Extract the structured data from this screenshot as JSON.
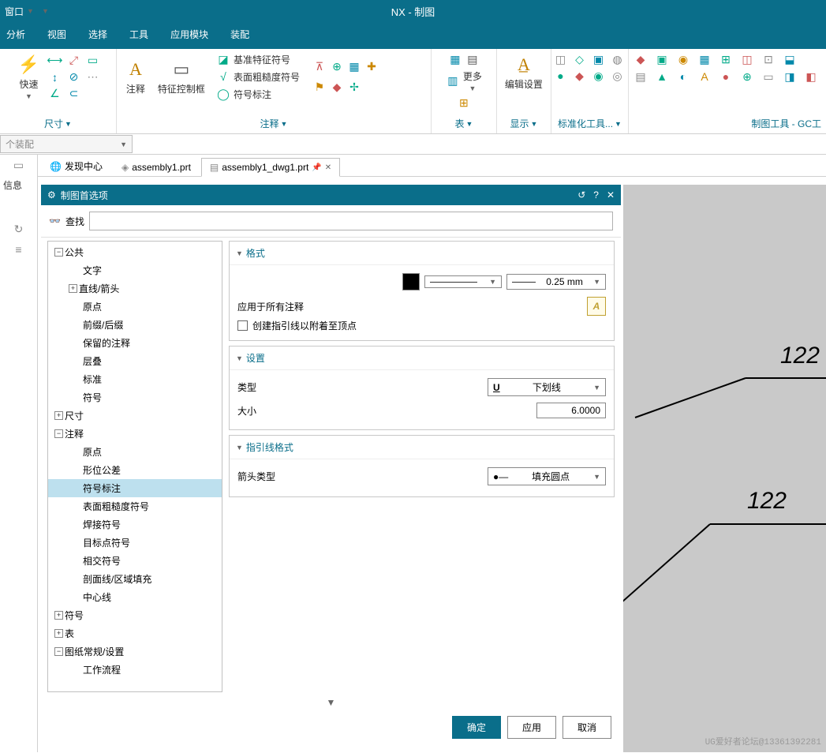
{
  "titlebar": {
    "window_menu": "窗口",
    "app_title": "NX - 制图"
  },
  "menubar": {
    "items": [
      "分析",
      "视图",
      "选择",
      "工具",
      "应用模块",
      "装配"
    ]
  },
  "ribbon": {
    "g1": {
      "quick": "快速",
      "label": "尺寸"
    },
    "g2": {
      "note": "注释",
      "featureFrame": "特征控制框",
      "opt1": "基准特征符号",
      "opt2": "表面粗糙度符号",
      "opt3": "符号标注",
      "label": "注释"
    },
    "g3": {
      "more": "更多",
      "label": "表"
    },
    "g4": {
      "edit": "编辑设置",
      "label": "显示"
    },
    "g5": {
      "label": "标准化工具..."
    },
    "g6": {
      "label": "制图工具 - GC工"
    }
  },
  "assemblyCombo": "个装配",
  "tabs": {
    "discover": "发现中心",
    "t1": "assembly1.prt",
    "t2": "assembly1_dwg1.prt"
  },
  "leftcol": {
    "info": "信息"
  },
  "dialog": {
    "title": "制图首选项",
    "searchLabel": "查找",
    "searchPlaceholder": "",
    "tree": {
      "n0": "公共",
      "n0c": [
        "文字",
        "直线/箭头",
        "原点",
        "前缀/后缀",
        "保留的注释",
        "层叠",
        "标准",
        "符号"
      ],
      "n1": "尺寸",
      "n2": "注释",
      "n2c": [
        "原点",
        "形位公差",
        "符号标注",
        "表面粗糙度符号",
        "焊接符号",
        "目标点符号",
        "相交符号",
        "剖面线/区域填充",
        "中心线"
      ],
      "n3": "符号",
      "n4": "表",
      "n5": "图纸常规/设置",
      "n5c": [
        "工作流程"
      ]
    },
    "sections": {
      "format": {
        "title": "格式",
        "width": "0.25 mm",
        "applyAll": "应用于所有注释",
        "createLeader": "创建指引线以附着至顶点"
      },
      "settings": {
        "title": "设置",
        "typeLabel": "类型",
        "typeValue": "下划线",
        "sizeLabel": "大小",
        "sizeValue": "6.0000"
      },
      "leader": {
        "title": "指引线格式",
        "arrowLabel": "箭头类型",
        "arrowValue": "填充圆点"
      }
    },
    "buttons": {
      "ok": "确定",
      "apply": "应用",
      "cancel": "取消"
    }
  },
  "canvas": {
    "label1": "122",
    "label2": "122"
  },
  "watermark": "UG爱好者论坛@13361392281"
}
